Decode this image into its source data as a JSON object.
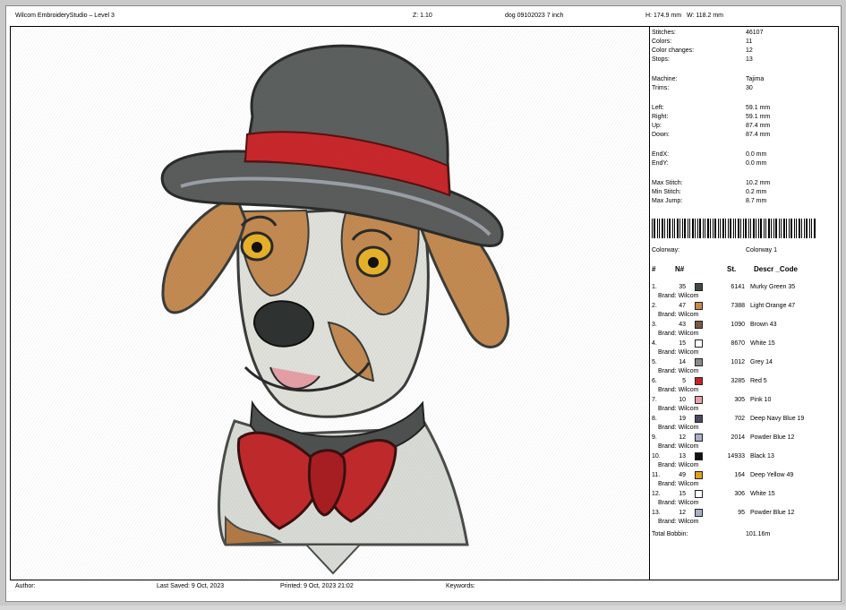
{
  "header": {
    "app_title": "Wilcom EmbroideryStudio – Level 3",
    "zoom": "Z: 1.10",
    "design_name": "dog 09102023 7  inch",
    "size_h": "H: 174.9 mm",
    "size_w": "W: 118.2 mm"
  },
  "stats": {
    "stitches_label": "Stitches:",
    "stitches": "46107",
    "colors_label": "Colors:",
    "colors": "11",
    "color_changes_label": "Color changes:",
    "color_changes": "12",
    "stops_label": "Stops:",
    "stops": "13",
    "machine_label": "Machine:",
    "machine": "Tajima",
    "trims_label": "Trims:",
    "trims": "30",
    "left_label": "Left:",
    "left": "59.1 mm",
    "right_label": "Right:",
    "right": "59.1 mm",
    "up_label": "Up:",
    "up": "87.4 mm",
    "down_label": "Down:",
    "down": "87.4 mm",
    "endx_label": "EndX:",
    "endx": "0.0 mm",
    "endy_label": "EndY:",
    "endy": "0.0 mm",
    "max_stitch_label": "Max Stitch:",
    "max_stitch": "10.2 mm",
    "min_stitch_label": "Min Stitch:",
    "min_stitch": "0.2 mm",
    "max_jump_label": "Max Jump:",
    "max_jump": "8.7 mm",
    "colorway_label": "Colorway:",
    "colorway": "Colorway 1"
  },
  "table": {
    "headers": [
      "#",
      "N#",
      "St.",
      "Descr _Code"
    ],
    "brand_label": "Brand: Wilcom",
    "rows": [
      {
        "idx": "1.",
        "n": "35",
        "st": "6141",
        "desc": "Murky Green 35",
        "color": "#3f4a44"
      },
      {
        "idx": "2.",
        "n": "47",
        "st": "7388",
        "desc": "Light Orange 47",
        "color": "#c98a48"
      },
      {
        "idx": "3.",
        "n": "43",
        "st": "1090",
        "desc": "Brown 43",
        "color": "#7a5a44"
      },
      {
        "idx": "4.",
        "n": "15",
        "st": "8670",
        "desc": "White 15",
        "color": "#ffffff"
      },
      {
        "idx": "5.",
        "n": "14",
        "st": "1012",
        "desc": "Grey 14",
        "color": "#8a8a8a"
      },
      {
        "idx": "6.",
        "n": "5",
        "st": "3285",
        "desc": "Red 5",
        "color": "#c8232b"
      },
      {
        "idx": "7.",
        "n": "10",
        "st": "305",
        "desc": "Pink 10",
        "color": "#e8a0a8"
      },
      {
        "idx": "8.",
        "n": "19",
        "st": "702",
        "desc": "Deep Navy Blue 19",
        "color": "#4a4a62"
      },
      {
        "idx": "9.",
        "n": "12",
        "st": "2014",
        "desc": "Powder Blue 12",
        "color": "#a8b0c8"
      },
      {
        "idx": "10.",
        "n": "13",
        "st": "14933",
        "desc": "Black 13",
        "color": "#111111"
      },
      {
        "idx": "11.",
        "n": "49",
        "st": "164",
        "desc": "Deep Yellow 49",
        "color": "#e0a020"
      },
      {
        "idx": "12.",
        "n": "15",
        "st": "306",
        "desc": "White 15",
        "color": "#ffffff"
      },
      {
        "idx": "13.",
        "n": "12",
        "st": "95",
        "desc": "Powder Blue 12",
        "color": "#a8b0c8"
      }
    ],
    "total_bobbin_label": "Total Bobbin:",
    "total_bobbin": "101.16m"
  },
  "footer": {
    "author": "Author:",
    "last_saved": "Last Saved:  9 Oct, 2023",
    "printed": "Printed:  9 Oct, 2023 21:02",
    "keywords": "Keywords:"
  }
}
